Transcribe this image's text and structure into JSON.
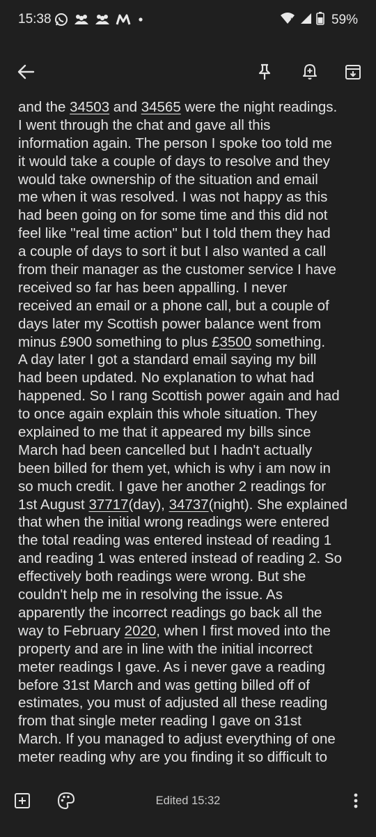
{
  "status_bar": {
    "time": "15:38",
    "battery_percent": "59%",
    "left_icons": [
      "whatsapp-icon",
      "group-icon",
      "group-icon",
      "m-app-icon",
      "dot-icon"
    ],
    "right_icons": [
      "wifi-icon",
      "signal-icon",
      "battery-icon"
    ]
  },
  "toolbar": {
    "icons": [
      "back-arrow-icon",
      "pin-icon",
      "add-reminder-icon",
      "archive-icon"
    ]
  },
  "note": {
    "lines": [
      [
        {
          "t": "and the "
        },
        {
          "t": "34503",
          "u": true
        },
        {
          "t": " and "
        },
        {
          "t": "34565",
          "u": true
        },
        {
          "t": " were the night readings."
        }
      ],
      [
        {
          "t": "I went through the chat and gave all this"
        }
      ],
      [
        {
          "t": "information again.  The person I spoke too told me"
        }
      ],
      [
        {
          "t": "it would take a couple of days to resolve and they"
        }
      ],
      [
        {
          "t": "would take ownership of the situation and email"
        }
      ],
      [
        {
          "t": "me when it was resolved.  I was not happy as this"
        }
      ],
      [
        {
          "t": "had been going on for some time and this did not"
        }
      ],
      [
        {
          "t": "feel like \"real time action\" but I told them they had"
        }
      ],
      [
        {
          "t": "a couple of days to sort it but I also wanted a call"
        }
      ],
      [
        {
          "t": "from their manager as the customer service I have"
        }
      ],
      [
        {
          "t": "received so far has been appalling. I never"
        }
      ],
      [
        {
          "t": "received an email or a phone call, but a couple of"
        }
      ],
      [
        {
          "t": "days later my Scottish power balance went from"
        }
      ],
      [
        {
          "t": "minus £900 something to plus £"
        },
        {
          "t": "3500",
          "u": true
        },
        {
          "t": " something."
        }
      ],
      [
        {
          "t": "A day later I got a standard email saying my bill"
        }
      ],
      [
        {
          "t": "had been updated.  No explanation to what had"
        }
      ],
      [
        {
          "t": "happened.  So I rang Scottish power again and had"
        }
      ],
      [
        {
          "t": "to once again explain this whole situation.  They"
        }
      ],
      [
        {
          "t": "explained to me that it appeared my bills since"
        }
      ],
      [
        {
          "t": "March had been cancelled but I hadn't actually"
        }
      ],
      [
        {
          "t": "been billed for them yet, which is why i am now in"
        }
      ],
      [
        {
          "t": "so much credit.   I gave her another 2 readings for"
        }
      ],
      [
        {
          "t": "1st August "
        },
        {
          "t": "37717",
          "u": true
        },
        {
          "t": "(day), "
        },
        {
          "t": "34737",
          "u": true
        },
        {
          "t": "(night). She explained"
        }
      ],
      [
        {
          "t": "that when the initial wrong readings were entered"
        }
      ],
      [
        {
          "t": "the total reading was entered instead of reading 1"
        }
      ],
      [
        {
          "t": "and reading 1 was entered instead of reading 2. So"
        }
      ],
      [
        {
          "t": "effectively both readings were wrong.  But she"
        }
      ],
      [
        {
          "t": "couldn't help me in resolving the issue. As"
        }
      ],
      [
        {
          "t": "apparently the incorrect readings go back all the"
        }
      ],
      [
        {
          "t": "way to February "
        },
        {
          "t": "2020",
          "u": true
        },
        {
          "t": ", when I first moved into the"
        }
      ],
      [
        {
          "t": "property and are in line with the initial incorrect"
        }
      ],
      [
        {
          "t": "meter readings I gave.  As i never gave a reading"
        }
      ],
      [
        {
          "t": "before 31st March and was getting billed off of"
        }
      ],
      [
        {
          "t": "estimates, you must of adjusted all these reading"
        }
      ],
      [
        {
          "t": "from that single meter reading I gave on 31st"
        }
      ],
      [
        {
          "t": "March. If you managed to adjust everything of one"
        }
      ],
      [
        {
          "t": "meter reading why are you finding it so difficult to"
        }
      ]
    ]
  },
  "bottom_bar": {
    "edited_label": "Edited 15:32",
    "icons": [
      "add-box-icon",
      "palette-icon",
      "more-vert-icon"
    ]
  }
}
